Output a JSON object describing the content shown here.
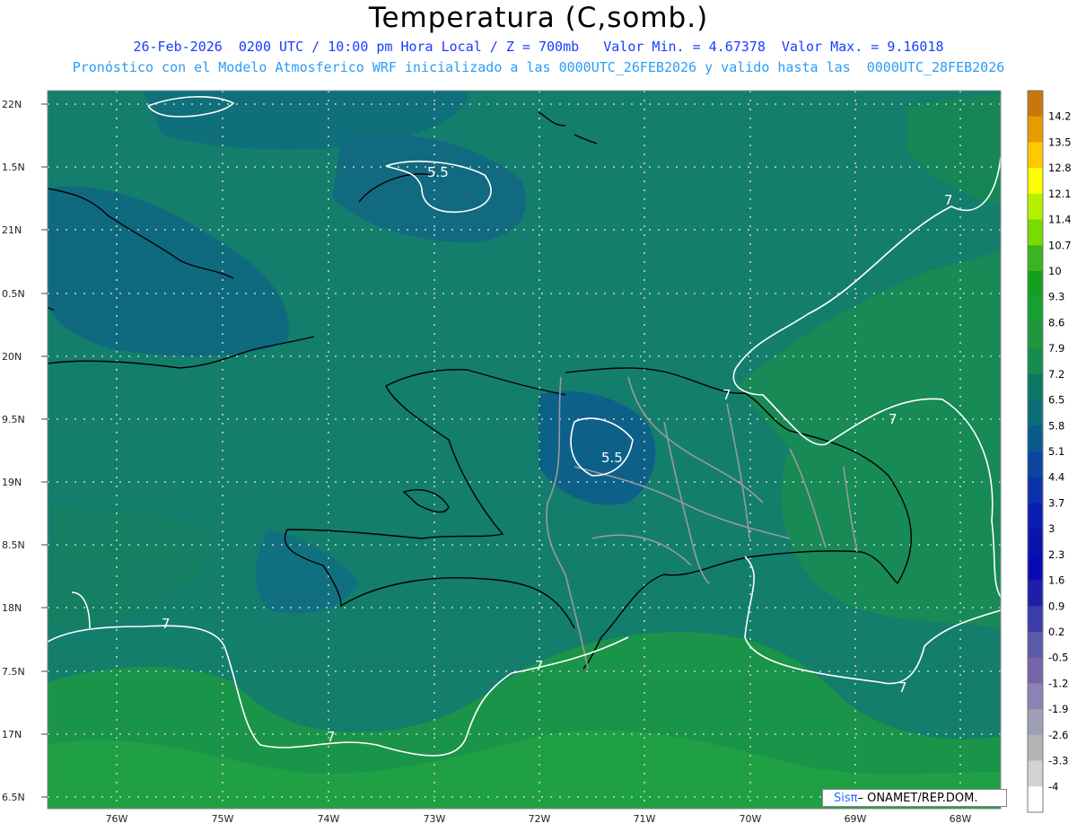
{
  "header": {
    "title": "Temperatura (C,somb.)",
    "line1": "26-Feb-2026  0200 UTC / 10:00 pm Hora Local / Z = 700mb   Valor Min. = 4.67378  Valor Max. = 9.16018",
    "line2": "Pronóstico con el Modelo Atmosferico WRF inicializado a las 0000UTC_26FEB2026 y valido hasta las  0000UTC_28FEB2026"
  },
  "map": {
    "lat_labels": [
      "22N",
      "1.5N",
      "21N",
      "0.5N",
      "20N",
      "9.5N",
      "19N",
      "8.5N",
      "18N",
      "7.5N",
      "17N",
      "6.5N"
    ],
    "lon_labels": [
      "76W",
      "75W",
      "74W",
      "73W",
      "72W",
      "71W",
      "70W",
      "69W",
      "68W"
    ],
    "contour_labels": [
      "5.5",
      "5.5",
      "7",
      "7",
      "7",
      "7",
      "7",
      "7",
      "7"
    ]
  },
  "colorbar": {
    "labels": [
      "14.2",
      "13.5",
      "12.8",
      "12.1",
      "11.4",
      "10.7",
      "10",
      "9.3",
      "8.6",
      "7.9",
      "7.2",
      "6.5",
      "5.8",
      "5.1",
      "4.4",
      "3.7",
      "3",
      "2.3",
      "1.6",
      "0.9",
      "0.2",
      "-0.5",
      "-1.2",
      "-1.9",
      "-2.6",
      "-3.3",
      "-4"
    ],
    "colors": [
      "#c8780a",
      "#e69b00",
      "#ffc800",
      "#ffff00",
      "#b4f000",
      "#78dc00",
      "#3cb41e",
      "#14a01e",
      "#14a032",
      "#1e963c",
      "#148c50",
      "#0a7864",
      "#0a6e78",
      "#0a5a8c",
      "#0a46a0",
      "#0a32aa",
      "#0a1eb4",
      "#0a14aa",
      "#0a0ab4",
      "#1e1eaa",
      "#3c3caa",
      "#5a5aaa",
      "#7864aa",
      "#8c82b4",
      "#a0a0b4",
      "#b4b4b4",
      "#d2d2d2",
      "#ffffff"
    ]
  },
  "credit": {
    "sis": "Sisπ",
    "rest": "– ONAMET/REP.DOM."
  }
}
